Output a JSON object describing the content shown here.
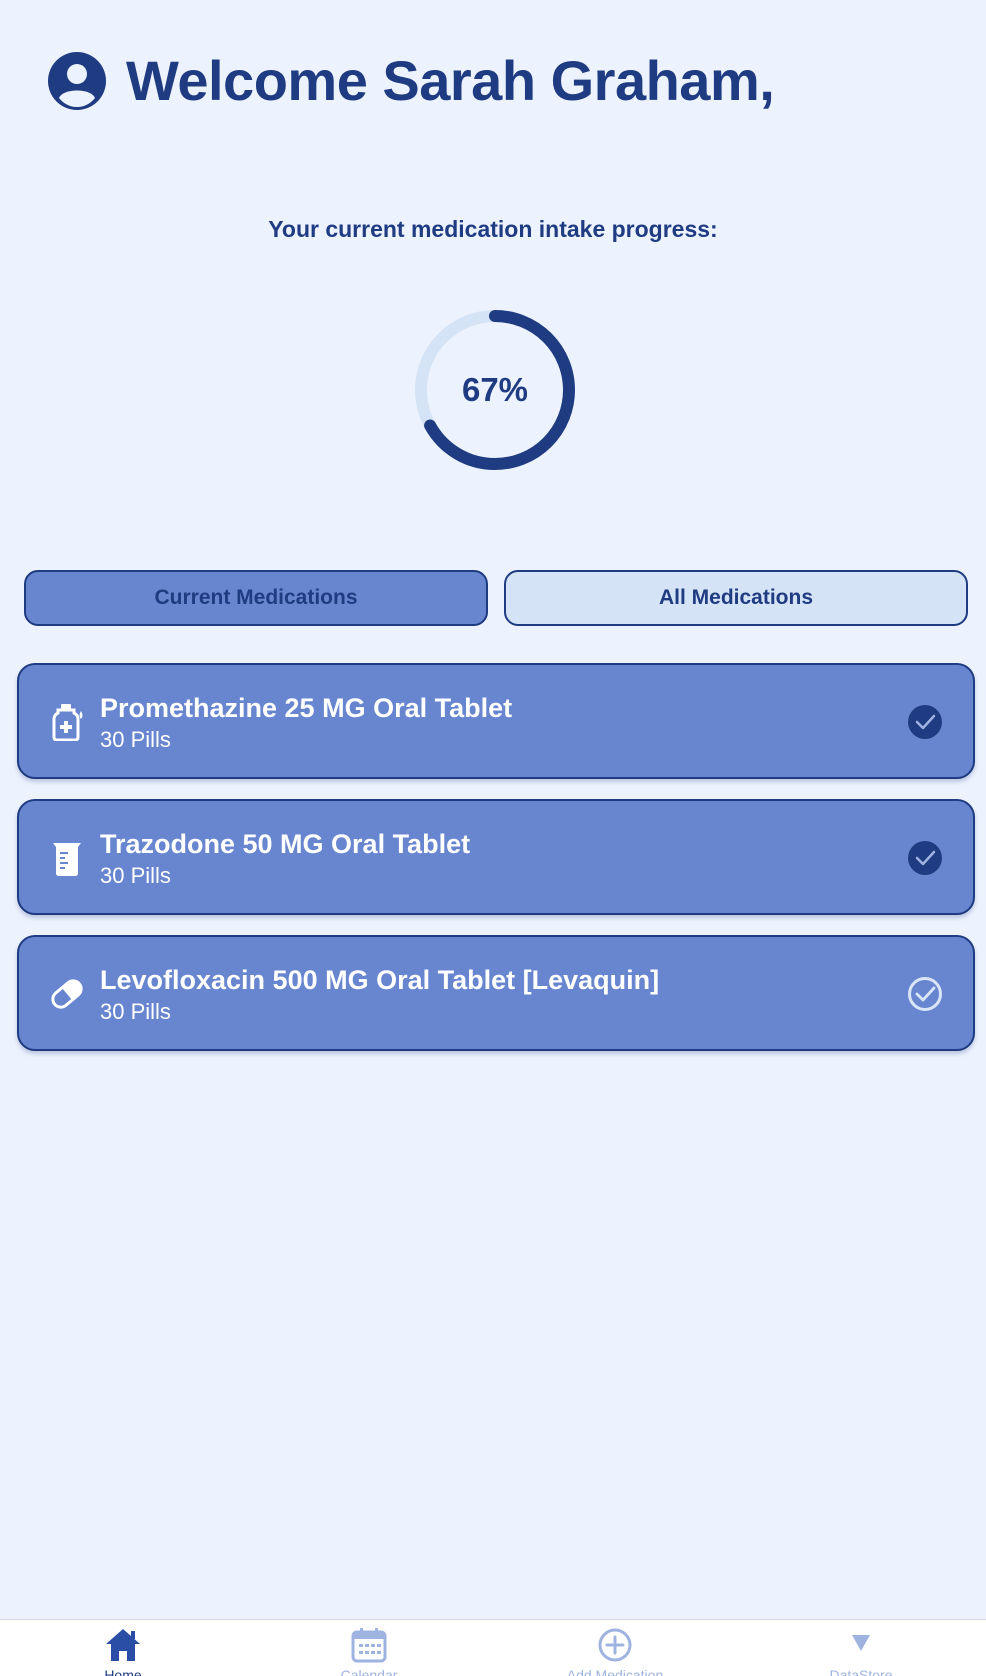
{
  "header": {
    "welcome_text": "Welcome Sarah Graham,",
    "avatar_icon": "user-circle-icon"
  },
  "progress": {
    "label": "Your current medication intake progress:",
    "percent_text": "67%",
    "fraction": 0.67
  },
  "tabs": {
    "current_label": "Current Medications",
    "all_label": "All Medications",
    "selected": "current"
  },
  "medications": [
    {
      "name": "Promethazine 25 MG Oral Tablet",
      "count": "30 Pills",
      "icon": "medicine-bottle-icon",
      "taken": true
    },
    {
      "name": "Trazodone 50 MG Oral Tablet",
      "count": "30 Pills",
      "icon": "medicine-cup-icon",
      "taken": true
    },
    {
      "name": "Levofloxacin 500 MG Oral Tablet [Levaquin]",
      "count": "30 Pills",
      "icon": "pill-capsule-icon",
      "taken": false
    }
  ],
  "nav": [
    {
      "label": "Home",
      "icon": "home-icon",
      "active": true
    },
    {
      "label": "Calendar",
      "icon": "calendar-icon",
      "active": false
    },
    {
      "label": "Add Medication",
      "icon": "add-circle-icon",
      "active": false
    },
    {
      "label": "DataStore",
      "icon": "triangle-down-icon",
      "active": false
    }
  ],
  "colors": {
    "primary": "#1f3b82",
    "card": "#6886cf",
    "background": "#edf3fe",
    "tab_inactive": "#d5e3f6",
    "nav_inactive": "#9fb3e0"
  }
}
